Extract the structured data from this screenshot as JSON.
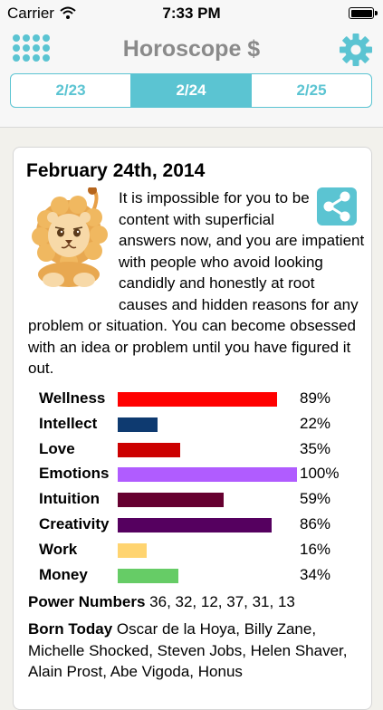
{
  "status_bar": {
    "carrier": "Carrier",
    "time": "7:33 PM"
  },
  "header": {
    "title": "Horoscope $",
    "menu_icon": "grid-icon",
    "settings_icon": "gear-icon"
  },
  "date_tabs": [
    {
      "label": "2/23",
      "active": false
    },
    {
      "label": "2/24",
      "active": true
    },
    {
      "label": "2/25",
      "active": false
    }
  ],
  "reading": {
    "date": "February 24th, 2014",
    "sign_image": "lion-icon",
    "share_icon": "share-icon",
    "text": "It is impossible for you to be content with superficial answers now, and you are impatient with people who avoid looking candidly and honestly at root causes and hidden reasons for any problem or situation. You can become obsessed with an idea or problem until you have figured it out."
  },
  "ratings": [
    {
      "label": "Wellness",
      "value": 89,
      "display": "89%",
      "color": "#ff0000"
    },
    {
      "label": "Intellect",
      "value": 22,
      "display": "22%",
      "color": "#0e3a70"
    },
    {
      "label": "Love",
      "value": 35,
      "display": "35%",
      "color": "#cc0000"
    },
    {
      "label": "Emotions",
      "value": 100,
      "display": "100%",
      "color": "#b05cff"
    },
    {
      "label": "Intuition",
      "value": 59,
      "display": "59%",
      "color": "#660030"
    },
    {
      "label": "Creativity",
      "value": 86,
      "display": "86%",
      "color": "#55005f"
    },
    {
      "label": "Work",
      "value": 16,
      "display": "16%",
      "color": "#ffd470"
    },
    {
      "label": "Money",
      "value": 34,
      "display": "34%",
      "color": "#66cc66"
    }
  ],
  "power_numbers": {
    "label": "Power Numbers",
    "value": "36, 32, 12, 37, 31, 13"
  },
  "born_today": {
    "label": "Born Today",
    "value": "Oscar de la Hoya, Billy Zane, Michelle Shocked, Steven Jobs, Helen Shaver, Alain Prost, Abe Vigoda, Honus"
  },
  "colors": {
    "accent": "#5bc4d2",
    "title_gray": "#8a8a8a",
    "background": "#f2f1ec"
  }
}
